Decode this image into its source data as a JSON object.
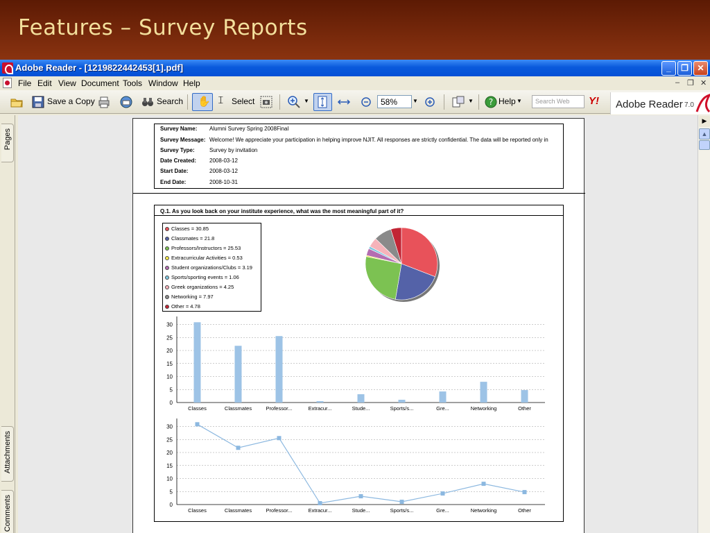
{
  "slide": {
    "title": "Features – Survey Reports"
  },
  "window": {
    "title": "Adobe Reader - [1219822442453[1].pdf]"
  },
  "menu": {
    "items": [
      "File",
      "Edit",
      "View",
      "Document",
      "Tools",
      "Window",
      "Help"
    ]
  },
  "toolbar": {
    "save_copy": "Save a Copy",
    "search": "Search",
    "select": "Select",
    "zoom": "58%",
    "help": "Help",
    "search_web_placeholder": "Search Web",
    "yahoo": "Y!",
    "brand": "Adobe Reader",
    "version": "7.0"
  },
  "side_tabs": {
    "pages": "Pages",
    "attachments": "Attachments",
    "comments": "Comments"
  },
  "survey": {
    "rows": [
      {
        "label": "Survey Name:",
        "value": "Alumni Survey Spring 2008Final"
      },
      {
        "label": "Survey Message:",
        "value": "Welcome!  We appreciate your participation in helping improve NJIT. All responses are strictly confidential.   The data will be reported only in"
      },
      {
        "label": "Survey Type:",
        "value": "Survey by invitation"
      },
      {
        "label": "Date Created:",
        "value": "2008-03-12"
      },
      {
        "label": "Start Date:",
        "value": "2008-03-12"
      },
      {
        "label": "End Date:",
        "value": "2008-10-31"
      }
    ],
    "question": "Q.1. As you look back on your institute experience, what was the most meaningful part of it?"
  },
  "legend": [
    {
      "label": "Classes = 30.85",
      "color": "#e8525a"
    },
    {
      "label": "Classmates = 21.8",
      "color": "#5462a8"
    },
    {
      "label": "Professors/Instructors = 25.53",
      "color": "#7cc252"
    },
    {
      "label": "Extracurricular Activities = 0.53",
      "color": "#f5e94a"
    },
    {
      "label": "Student organizations/Clubs = 3.19",
      "color": "#b46db1"
    },
    {
      "label": "Sports/sporting events = 1.06",
      "color": "#7fc7df"
    },
    {
      "label": "Greek organizations = 4.25",
      "color": "#f6b3ba"
    },
    {
      "label": "Networking = 7.97",
      "color": "#8a8a8a"
    },
    {
      "label": "Other = 4.78",
      "color": "#c22535"
    }
  ],
  "chart_data": [
    {
      "type": "pie",
      "categories": [
        "Classes",
        "Classmates",
        "Professors/Instructors",
        "Extracurricular Activities",
        "Student organizations/Clubs",
        "Sports/sporting events",
        "Greek organizations",
        "Networking",
        "Other"
      ],
      "values": [
        30.85,
        21.8,
        25.53,
        0.53,
        3.19,
        1.06,
        4.25,
        7.97,
        4.78
      ],
      "colors": [
        "#e8525a",
        "#5462a8",
        "#7cc252",
        "#f5e94a",
        "#b46db1",
        "#7fc7df",
        "#f6b3ba",
        "#8a8a8a",
        "#c22535"
      ]
    },
    {
      "type": "bar",
      "categories": [
        "Classes",
        "Classmates",
        "Professor...",
        "Extracur...",
        "Stude...",
        "Sports/s...",
        "Gre...",
        "Networking",
        "Other"
      ],
      "values": [
        30.85,
        21.8,
        25.53,
        0.53,
        3.19,
        1.06,
        4.25,
        7.97,
        4.78
      ],
      "yticks": [
        0,
        5,
        10,
        15,
        20,
        25,
        30
      ],
      "ylim": [
        0,
        32
      ],
      "grid": true,
      "color": "#9dc3e6"
    },
    {
      "type": "line",
      "categories": [
        "Classes",
        "Classmates",
        "Professor...",
        "Extracur...",
        "Stude...",
        "Sports/s...",
        "Gre...",
        "Networking",
        "Other"
      ],
      "values": [
        30.85,
        21.8,
        25.53,
        0.53,
        3.19,
        1.06,
        4.25,
        7.97,
        4.78
      ],
      "yticks": [
        0,
        5,
        10,
        15,
        20,
        25,
        30
      ],
      "ylim": [
        0,
        32
      ],
      "grid": true,
      "color": "#8cb8e0"
    }
  ]
}
